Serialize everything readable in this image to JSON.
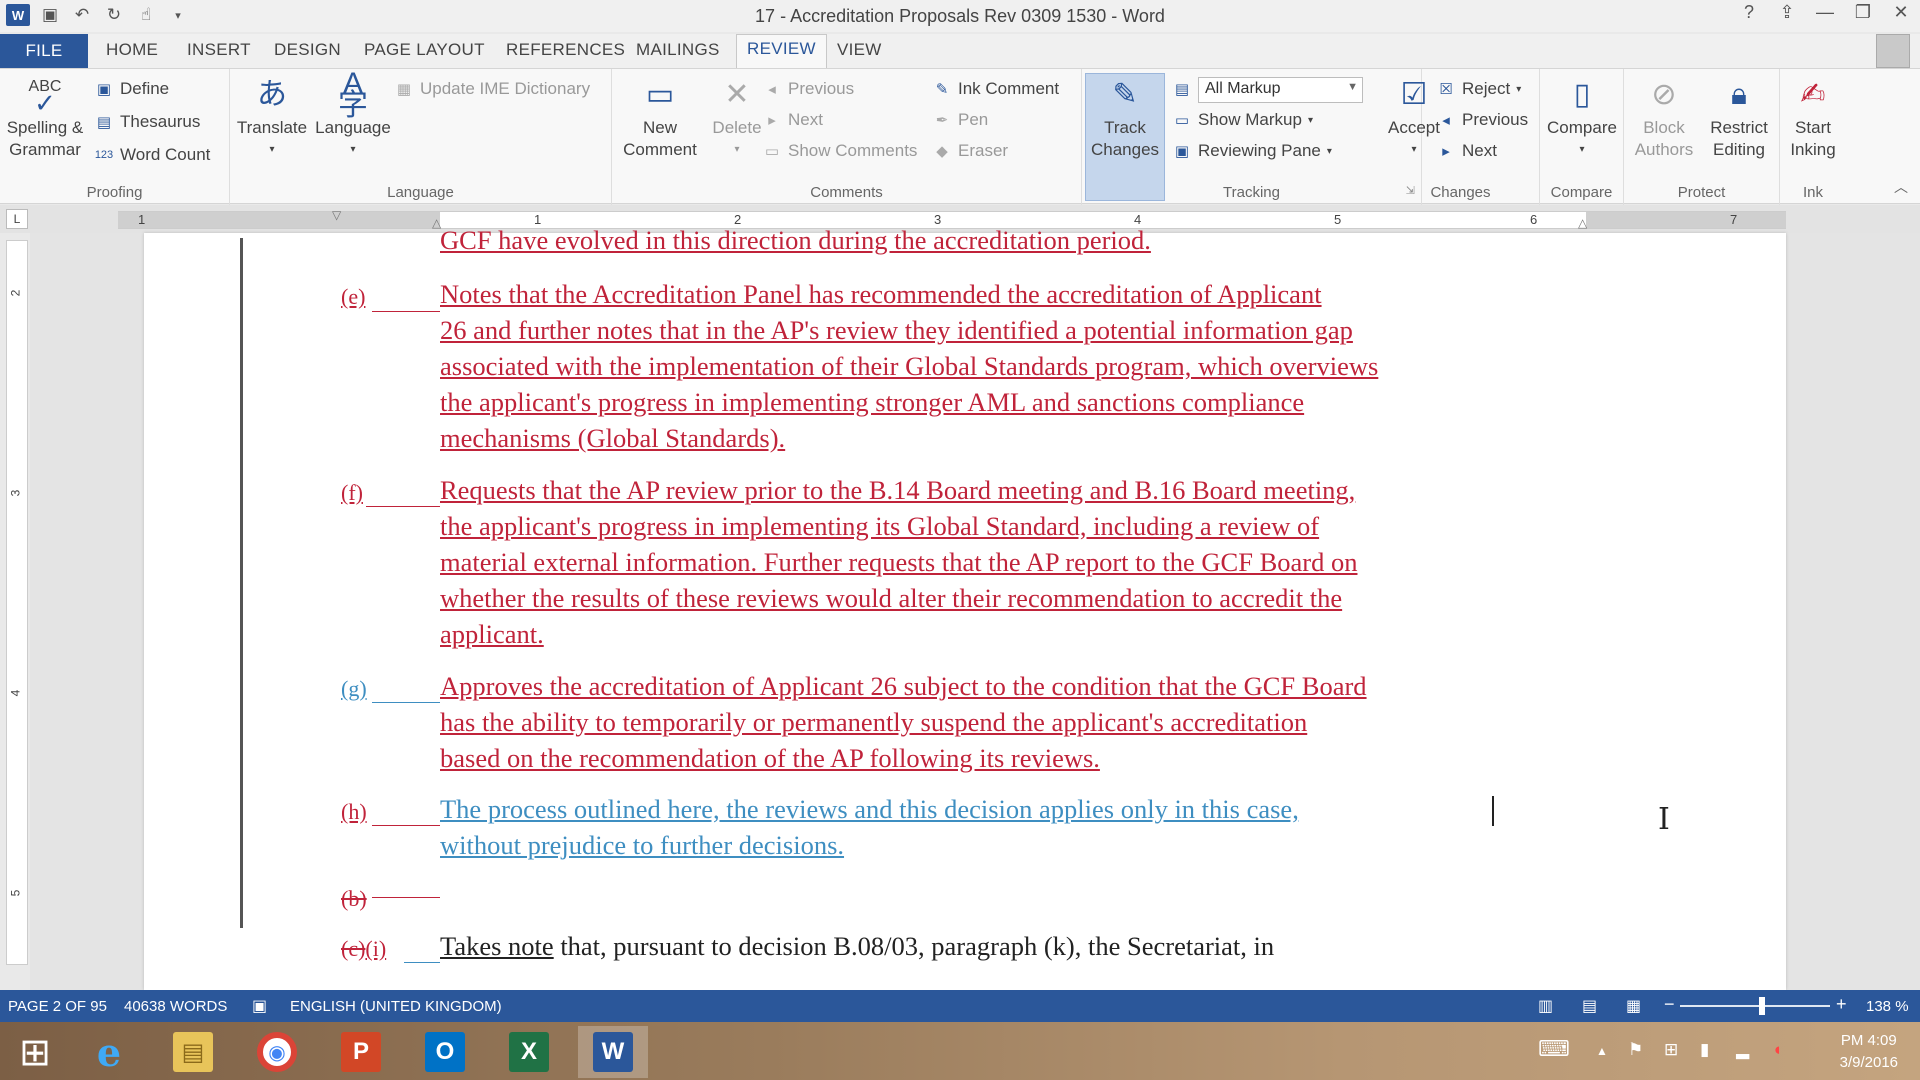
{
  "window": {
    "title": "17 - Accreditation Proposals Rev 0309 1530 - Word",
    "app_badge": "W",
    "controls": {
      "help": "?",
      "ribbon_display": "⇪",
      "minimize": "—",
      "restore": "❐",
      "close": "✕"
    }
  },
  "tabs": [
    {
      "label": "FILE"
    },
    {
      "label": "HOME"
    },
    {
      "label": "INSERT"
    },
    {
      "label": "DESIGN"
    },
    {
      "label": "PAGE LAYOUT"
    },
    {
      "label": "REFERENCES"
    },
    {
      "label": "MAILINGS"
    },
    {
      "label": "REVIEW",
      "active": true
    },
    {
      "label": "VIEW"
    }
  ],
  "ribbon": {
    "proofing": {
      "label": "Proofing",
      "spelling": "Spelling &",
      "spelling2": "Grammar",
      "spelling_abc": "ABC",
      "define": "Define",
      "thesaurus": "Thesaurus",
      "word_count": "Word Count"
    },
    "language": {
      "label": "Language",
      "translate": "Translate",
      "language": "Language",
      "update_ime": "Update IME Dictionary"
    },
    "comments": {
      "label": "Comments",
      "new_comment": "New",
      "new_comment2": "Comment",
      "delete": "Delete",
      "previous": "Previous",
      "next": "Next",
      "show_comments": "Show Comments",
      "ink_comment": "Ink Comment",
      "pen": "Pen",
      "eraser": "Eraser"
    },
    "tracking": {
      "label": "Tracking",
      "track_changes": "Track",
      "track_changes2": "Changes",
      "all_markup": "All Markup",
      "show_markup": "Show Markup",
      "reviewing_pane": "Reviewing Pane"
    },
    "changes": {
      "label": "Changes",
      "accept": "Accept",
      "reject": "Reject",
      "previous": "Previous",
      "next": "Next"
    },
    "compare": {
      "label": "Compare",
      "compare": "Compare"
    },
    "protect": {
      "label": "Protect",
      "block": "Block",
      "block2": "Authors",
      "restrict": "Restrict",
      "restrict2": "Editing"
    },
    "ink": {
      "label": "Ink",
      "start": "Start",
      "start2": "Inking"
    }
  },
  "ruler": {
    "corner": "L",
    "numbers": [
      "1",
      "1",
      "2",
      "3",
      "4",
      "5",
      "6",
      "7"
    ],
    "v_numbers": [
      "2",
      "3",
      "4",
      "5"
    ]
  },
  "document": {
    "top_line": "GCF have evolved in this direction during the accreditation period.",
    "paragraphs": [
      {
        "num": "(e)",
        "lines": [
          "Notes that the Accreditation Panel has recommended the accreditation of Applicant",
          "26 and further notes  that in the AP's review they identified a potential information gap",
          "associated with the implementation of their Global Standards program, which overviews",
          "the applicant's progress in implementing stronger AML and sanctions compliance",
          "mechanisms (Global Standards)."
        ]
      },
      {
        "num": "(f)",
        "lines": [
          "Requests that the AP review prior to the B.14 Board meeting and B.16 Board meeting,",
          "the applicant's progress in implementing its Global Standard, including a review of",
          "material external information. Further requests that the AP report to the GCF Board on",
          "whether the results of these reviews would alter their recommendation to accredit the",
          "applicant."
        ]
      },
      {
        "num": "(g)",
        "lines": [
          "Approves the accreditation of Applicant 26 subject to the condition that the GCF Board",
          "has the ability to temporarily or permanently suspend the applicant's accreditation",
          "based on the recommendation of the AP following its reviews."
        ]
      },
      {
        "num": "(h)",
        "lines": [
          "The process outlined here, the reviews and this decision applies only in this case,",
          "without prejudice to further decisions."
        ]
      },
      {
        "num": "(b)"
      },
      {
        "num_deleted": "(c)",
        "num_inserted": "(i)",
        "lead": "Takes note",
        "rest": " that, pursuant to decision B.08/03, paragraph (k), the Secretariat, in"
      }
    ]
  },
  "status": {
    "page": "PAGE 2 OF 95",
    "words": "40638 WORDS",
    "language": "ENGLISH (UNITED KINGDOM)",
    "zoom": "138 %",
    "zoom_minus": "−",
    "zoom_plus": "+"
  },
  "taskbar": {
    "apps": [
      {
        "name": "start",
        "glyph": "⊞"
      },
      {
        "name": "ie",
        "glyph": "e"
      },
      {
        "name": "explorer",
        "glyph": "▤"
      },
      {
        "name": "chrome",
        "glyph": "◉"
      },
      {
        "name": "powerpoint",
        "glyph": "P"
      },
      {
        "name": "outlook",
        "glyph": "O"
      },
      {
        "name": "excel",
        "glyph": "X"
      },
      {
        "name": "word",
        "glyph": "W"
      }
    ],
    "time": "PM 4:09",
    "date": "3/9/2016"
  },
  "colors": {
    "word_blue": "#2b579a",
    "insert_red": "#c0233a",
    "insert_blue": "#3e8ec1"
  }
}
